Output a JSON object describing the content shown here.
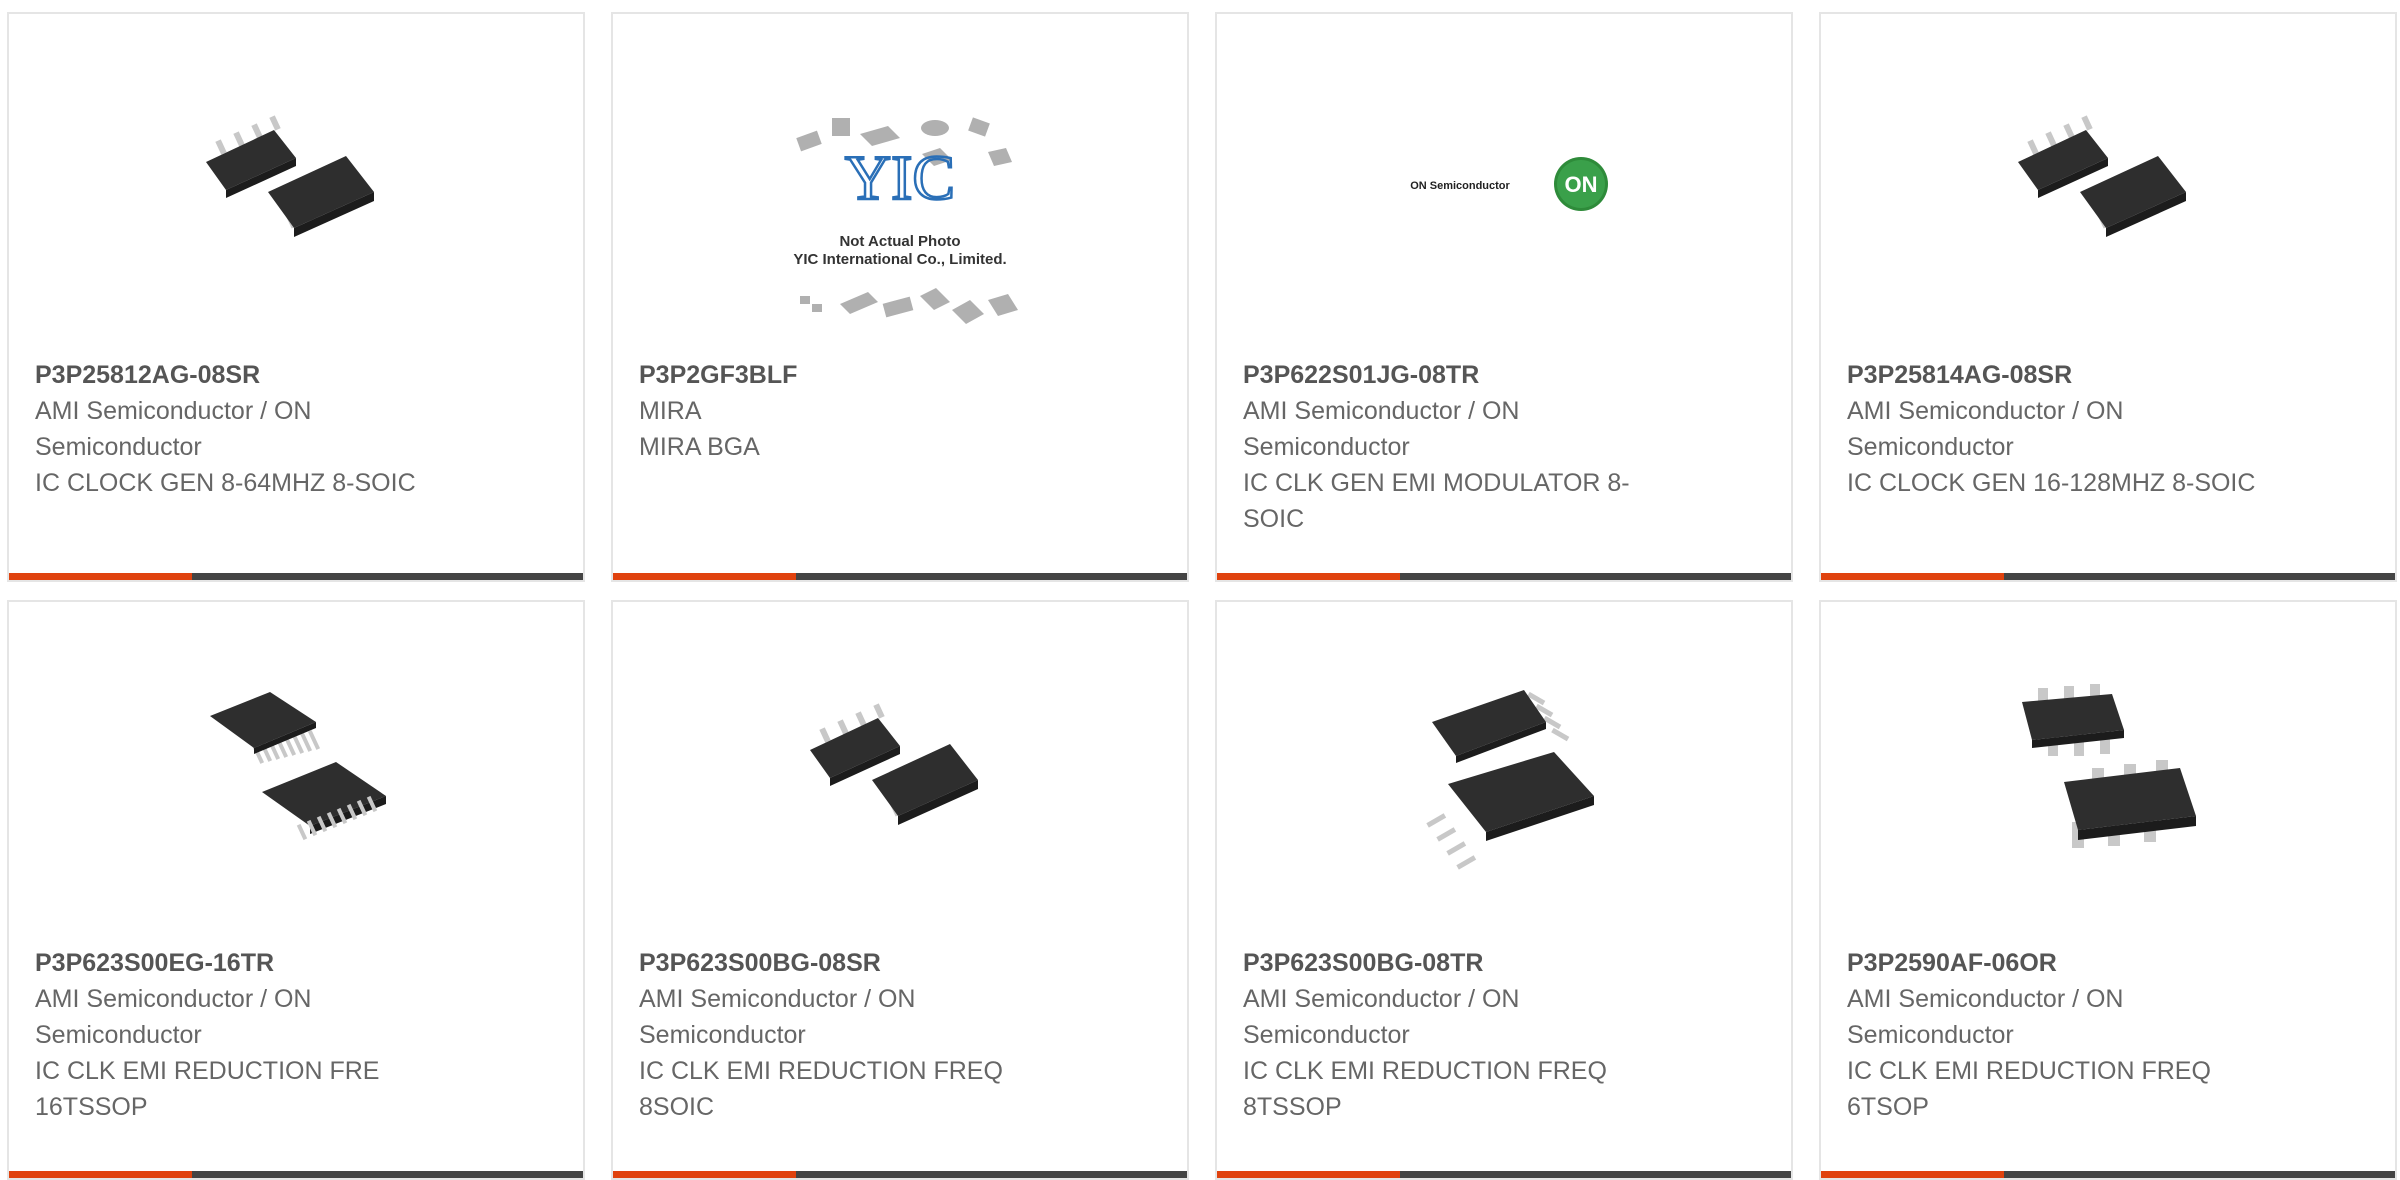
{
  "colors": {
    "accent": "#e0420e",
    "bar": "#444444",
    "border": "#e5e5e5"
  },
  "products": [
    {
      "part": "P3P25812AG-08SR",
      "manufacturer": "AMI Semiconductor / ON Semiconductor",
      "description": "IC CLOCK GEN 8-64MHZ 8-SOIC",
      "image": "soic8-chip-icon"
    },
    {
      "part": "P3P2GF3BLF",
      "manufacturer": "MIRA",
      "description": "MIRA BGA",
      "image": "yic-placeholder-icon",
      "placeholder": {
        "logo": "YIC",
        "line1": "Not Actual Photo",
        "line2": "YIC International Co., Limited."
      }
    },
    {
      "part": "P3P622S01JG-08TR",
      "manufacturer": "AMI Semiconductor / ON Semiconductor",
      "description": "IC CLK GEN EMI MODULATOR 8-SOIC",
      "image": "on-semiconductor-logo",
      "logo": {
        "text": "ON Semiconductor",
        "badge": "ON"
      }
    },
    {
      "part": "P3P25814AG-08SR",
      "manufacturer": "AMI Semiconductor / ON Semiconductor",
      "description": "IC CLOCK GEN 16-128MHZ 8-SOIC",
      "image": "soic8-chip-icon"
    },
    {
      "part": "P3P623S00EG-16TR",
      "manufacturer": "AMI Semiconductor / ON Semiconductor",
      "description": "IC CLK EMI REDUCTION FRE 16TSSOP",
      "image": "tssop16-chip-icon"
    },
    {
      "part": "P3P623S00BG-08SR",
      "manufacturer": "AMI Semiconductor / ON Semiconductor",
      "description": "IC CLK EMI REDUCTION FREQ 8SOIC",
      "image": "soic8-chip-icon"
    },
    {
      "part": "P3P623S00BG-08TR",
      "manufacturer": "AMI Semiconductor / ON Semiconductor",
      "description": "IC CLK EMI REDUCTION FREQ 8TSSOP",
      "image": "tssop8-chip-icon"
    },
    {
      "part": "P3P2590AF-06OR",
      "manufacturer": "AMI Semiconductor / ON Semiconductor",
      "description": "IC CLK EMI REDUCTION FREQ 6TSOP",
      "image": "tsop6-chip-icon"
    }
  ]
}
